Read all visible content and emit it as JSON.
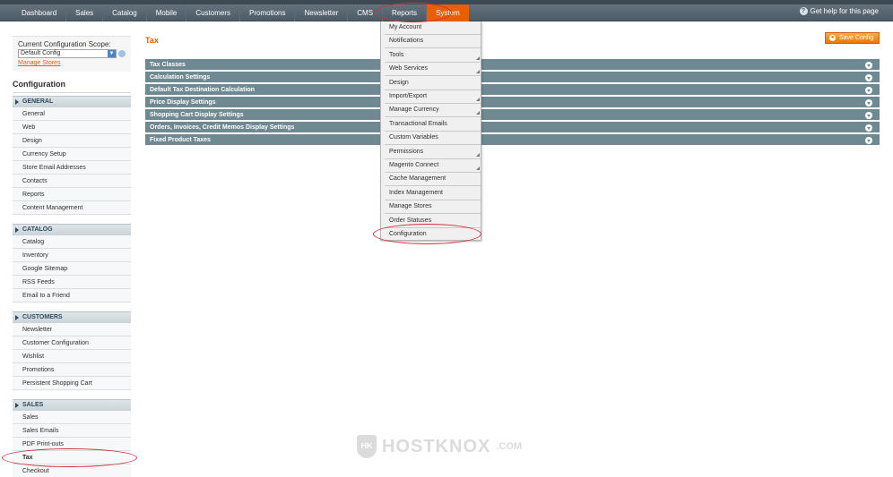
{
  "topnav": {
    "items": [
      "Dashboard",
      "Sales",
      "Catalog",
      "Mobile",
      "Customers",
      "Promotions",
      "Newsletter",
      "CMS",
      "Reports",
      "System"
    ],
    "active": "System",
    "help_text": "Get help for this page"
  },
  "scope": {
    "label": "Current Configuration Scope:",
    "selected": "Default Config",
    "manage_link": "Manage Stores"
  },
  "sidebar": {
    "title": "Configuration",
    "sections": [
      {
        "label": "GENERAL",
        "items": [
          "General",
          "Web",
          "Design",
          "Currency Setup",
          "Store Email Addresses",
          "Contacts",
          "Reports",
          "Content Management"
        ]
      },
      {
        "label": "CATALOG",
        "items": [
          "Catalog",
          "Inventory",
          "Google Sitemap",
          "RSS Feeds",
          "Email to a Friend"
        ]
      },
      {
        "label": "CUSTOMERS",
        "items": [
          "Newsletter",
          "Customer Configuration",
          "Wishlist",
          "Promotions",
          "Persistent Shopping Cart"
        ]
      },
      {
        "label": "SALES",
        "items": [
          "Sales",
          "Sales Emails",
          "PDF Print-outs",
          "Tax",
          "Checkout"
        ]
      }
    ],
    "current_item": "Tax"
  },
  "main": {
    "title": "Tax",
    "save_label": "Save Config",
    "sections": [
      "Tax Classes",
      "Calculation Settings",
      "Default Tax Destination Calculation",
      "Price Display Settings",
      "Shopping Cart Display Settings",
      "Orders, Invoices, Credit Memos Display Settings",
      "Fixed Product Taxes"
    ]
  },
  "system_menu": {
    "items": [
      {
        "label": "My Account",
        "submenu": false
      },
      {
        "label": "Notifications",
        "submenu": false
      },
      {
        "label": "Tools",
        "submenu": true
      },
      {
        "label": "Web Services",
        "submenu": true
      },
      {
        "label": "Design",
        "submenu": false
      },
      {
        "label": "Import/Export",
        "submenu": true
      },
      {
        "label": "Manage Currency",
        "submenu": true
      },
      {
        "label": "Transactional Emails",
        "submenu": false
      },
      {
        "label": "Custom Variables",
        "submenu": false
      },
      {
        "label": "Permissions",
        "submenu": true
      },
      {
        "label": "Magento Connect",
        "submenu": true
      },
      {
        "label": "Cache Management",
        "submenu": false
      },
      {
        "label": "Index Management",
        "submenu": false
      },
      {
        "label": "Manage Stores",
        "submenu": false
      },
      {
        "label": "Order Statuses",
        "submenu": false
      },
      {
        "label": "Configuration",
        "submenu": false
      }
    ]
  },
  "watermark": {
    "brand": "HOSTKNOX",
    "suffix": ".COM"
  },
  "colors": {
    "accent": "#eb5e00",
    "section_bar": "#6f8992",
    "nav_bg": "#4d5b66",
    "annotation": "#d0303a"
  }
}
